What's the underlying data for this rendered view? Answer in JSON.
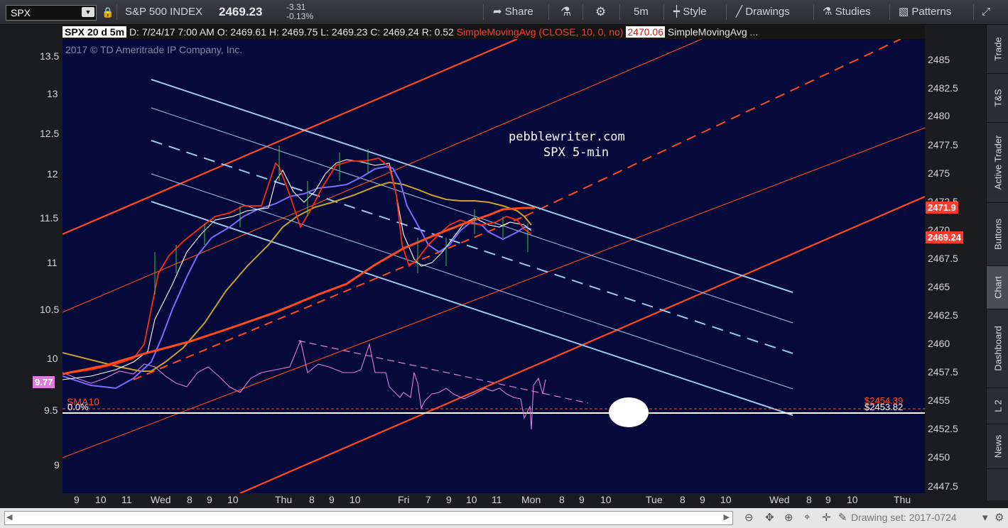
{
  "toolbar": {
    "symbol": "SPX",
    "symbol_desc": "S&P 500 INDEX",
    "last": "2469.23",
    "change": "-3.31",
    "change_pct": "-0.13%",
    "share": "Share",
    "timeframe": "5m",
    "style": "Style",
    "drawings": "Drawings",
    "studies": "Studies",
    "patterns": "Patterns"
  },
  "infobar": {
    "chart_id": "SPX 20 d 5m",
    "date": "D: 7/24/17 7:00 AM",
    "open": "O: 2469.61",
    "high": "H: 2469.75",
    "low": "L: 2469.23",
    "close": "C: 2469.24",
    "range": "R: 0.52",
    "study1": "SimpleMovingAvg (CLOSE, 10, 0, no)",
    "study1_val": "2470.06",
    "study2": "SimpleMovingAvg ..."
  },
  "watermark": "2017 © TD Ameritrade IP Company, Inc.",
  "annotation": {
    "line1": "pebblewriter.com",
    "line2": "SPX 5-min"
  },
  "left_axis_labels": [
    "13.5",
    "13",
    "12.5",
    "12",
    "11.5",
    "11",
    "10.5",
    "10",
    "9.5",
    "9"
  ],
  "right_axis_labels": [
    "2485",
    "2482.5",
    "2480",
    "2477.5",
    "2475",
    "2472.5",
    "2470",
    "2467.5",
    "2465",
    "2462.5",
    "2460",
    "2457.5",
    "2455",
    "2452.5",
    "2450",
    "2447.5"
  ],
  "x_labels": [
    "9",
    "10",
    "11",
    "Wed",
    "8",
    "9",
    "10",
    "Thu",
    "8",
    "9",
    "10",
    "Fri",
    "7",
    "9",
    "10",
    "11",
    "Mon",
    "8",
    "9",
    "10",
    "Tue",
    "8",
    "9",
    "10",
    "Wed",
    "8",
    "9",
    "10",
    "Thu"
  ],
  "badges": {
    "vix": "9.77",
    "price1": "2471.9",
    "price2": "2469.24",
    "level1": "$2454.39",
    "level2": "$2453.82",
    "sma_label": "SMA10",
    "fib_label": "0.0%"
  },
  "sidebar_tabs": [
    "Trade",
    "T&S",
    "Active Trader",
    "Buttons",
    "Chart",
    "Dashboard",
    "L 2",
    "News"
  ],
  "bottom": {
    "drawing_set": "Drawing set: 2017-0724"
  },
  "colors": {
    "chart_bg": "#050a3a",
    "orange": "#ff4a1a",
    "lightblue": "#9ec7ea",
    "purple": "#7a6cff",
    "gold": "#c9a227",
    "pink": "#e07be0"
  }
}
